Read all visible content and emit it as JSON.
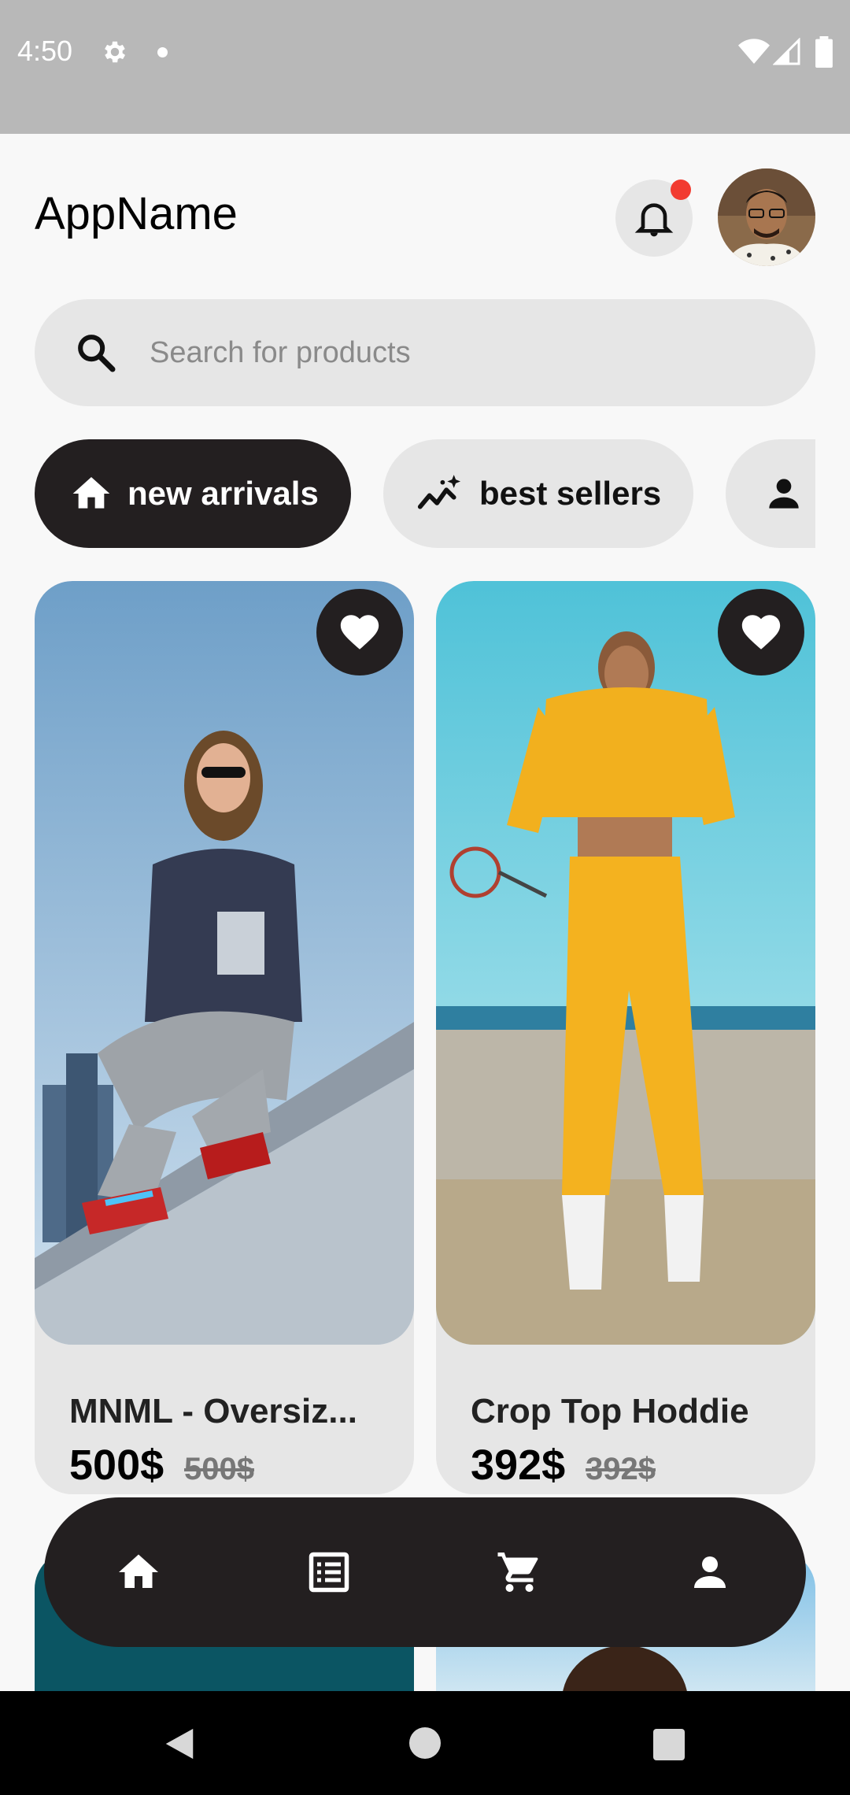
{
  "status_bar": {
    "time": "4:50",
    "icons": [
      "gear-icon",
      "dot-icon",
      "wifi-icon",
      "signal-icon",
      "battery-icon"
    ]
  },
  "header": {
    "title": "AppName",
    "notification_icon": "bell-icon",
    "has_notification": true,
    "avatar": "user-avatar"
  },
  "search": {
    "icon": "search-icon",
    "placeholder": "Search for products"
  },
  "categories": [
    {
      "label": "new arrivals",
      "icon": "home-icon",
      "selected": true
    },
    {
      "label": "best sellers",
      "icon": "trending-icon",
      "selected": false
    },
    {
      "label": "",
      "icon": "person-icon",
      "selected": false
    }
  ],
  "products": [
    {
      "name": "MNML - Oversiz...",
      "price": "500$",
      "old_price": "500$",
      "favorite": true,
      "image": "woman in grey sweatpants and sunglasses squatting"
    },
    {
      "name": "Crop Top Hoddie",
      "price": "392$",
      "old_price": "392$",
      "favorite": true,
      "image": "woman in yellow crop hoodie and joggers"
    }
  ],
  "bottom_nav": {
    "items": [
      {
        "icon": "home-icon",
        "active": true
      },
      {
        "icon": "list-icon",
        "active": false
      },
      {
        "icon": "cart-icon",
        "active": false
      },
      {
        "icon": "person-icon",
        "active": false
      }
    ]
  },
  "system_nav": [
    "back",
    "home",
    "recents"
  ],
  "colors": {
    "dark": "#231f20",
    "chip_bg": "#e6e6e6",
    "notification": "#f23b30",
    "background": "#f8f8f8"
  }
}
